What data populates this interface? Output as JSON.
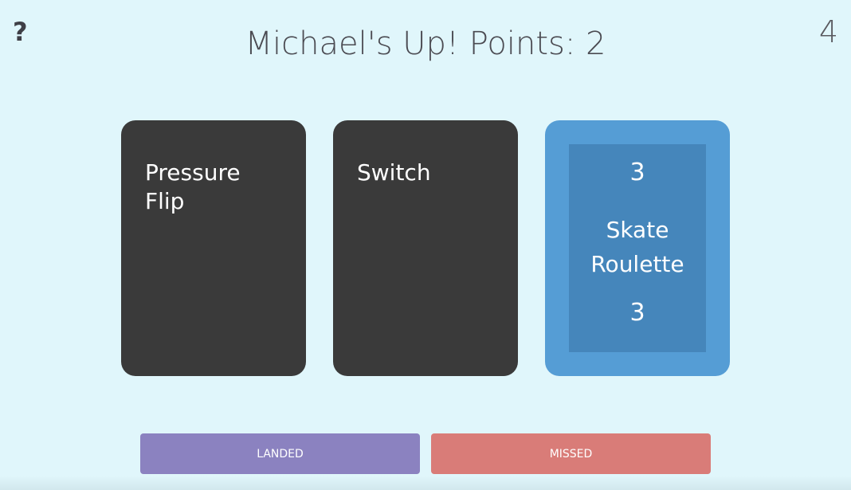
{
  "header": {
    "help_icon_glyph": "?",
    "title": "Michael's Up! Points: 2",
    "counter": "4"
  },
  "cards": [
    {
      "type": "trick",
      "label": "Pressure Flip"
    },
    {
      "type": "trick",
      "label": "Switch"
    },
    {
      "type": "deck",
      "top_number": "3",
      "title": "Skate Roulette",
      "bottom_number": "3"
    }
  ],
  "actions": {
    "landed_label": "LANDED",
    "missed_label": "MISSED"
  },
  "colors": {
    "background": "#e0f6fb",
    "card_dark": "#3a3a3a",
    "card_blue": "#559dd5",
    "card_blue_inner": "#4586bb",
    "landed": "#8b82c0",
    "missed": "#d97c78"
  }
}
